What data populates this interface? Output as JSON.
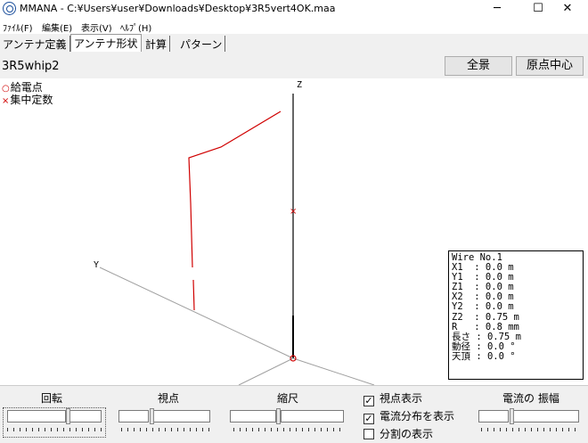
{
  "window": {
    "title": "MMANA - C:¥Users¥user¥Downloads¥Desktop¥3R5vert4OK.maa",
    "minimize": "─",
    "maximize": "☐",
    "close": "✕"
  },
  "menu": [
    "ﾌｧｲﾙ(F)",
    "編集(E)",
    "表示(V)",
    "ﾍﾙﾌﾟ(H)"
  ],
  "tabs": [
    "アンテナ定義",
    "アンテナ形状",
    "計算",
    "パターン"
  ],
  "active_tab": "アンテナ形状",
  "model_name": "3R5whip2",
  "buttons": {
    "full_view": "全景",
    "origin_center": "原点中心"
  },
  "legend": {
    "feed_marker": "○",
    "feed": "給電点",
    "load_marker": "×",
    "load": "集中定数"
  },
  "axes": {
    "z": "Z",
    "y": "Y"
  },
  "wire_info": [
    "Wire No.1",
    "X1  : 0.0 m",
    "Y1  : 0.0 m",
    "Z1  : 0.0 m",
    "X2  : 0.0 m",
    "Y2  : 0.0 m",
    "Z2  : 0.75 m",
    "R   : 0.8 mm",
    "長さ : 0.75 m",
    "動径 : 0.0 °",
    "天頂 : 0.0 °"
  ],
  "controls": {
    "rotation": "回転",
    "viewpoint": "視点",
    "scale": "縮尺",
    "show_viewpoint": {
      "label": "視点表示",
      "checked": true,
      "mark": "✓"
    },
    "show_current": {
      "label": "電流分布を表示",
      "checked": true,
      "mark": "✓"
    },
    "show_segments": {
      "label": "分割の表示",
      "checked": false,
      "mark": ""
    },
    "current_amplitude": "電流の 振幅"
  },
  "colors": {
    "wire_red": "#d00000",
    "axis_black": "#000000",
    "axis_gray": "#a0a0a0"
  }
}
